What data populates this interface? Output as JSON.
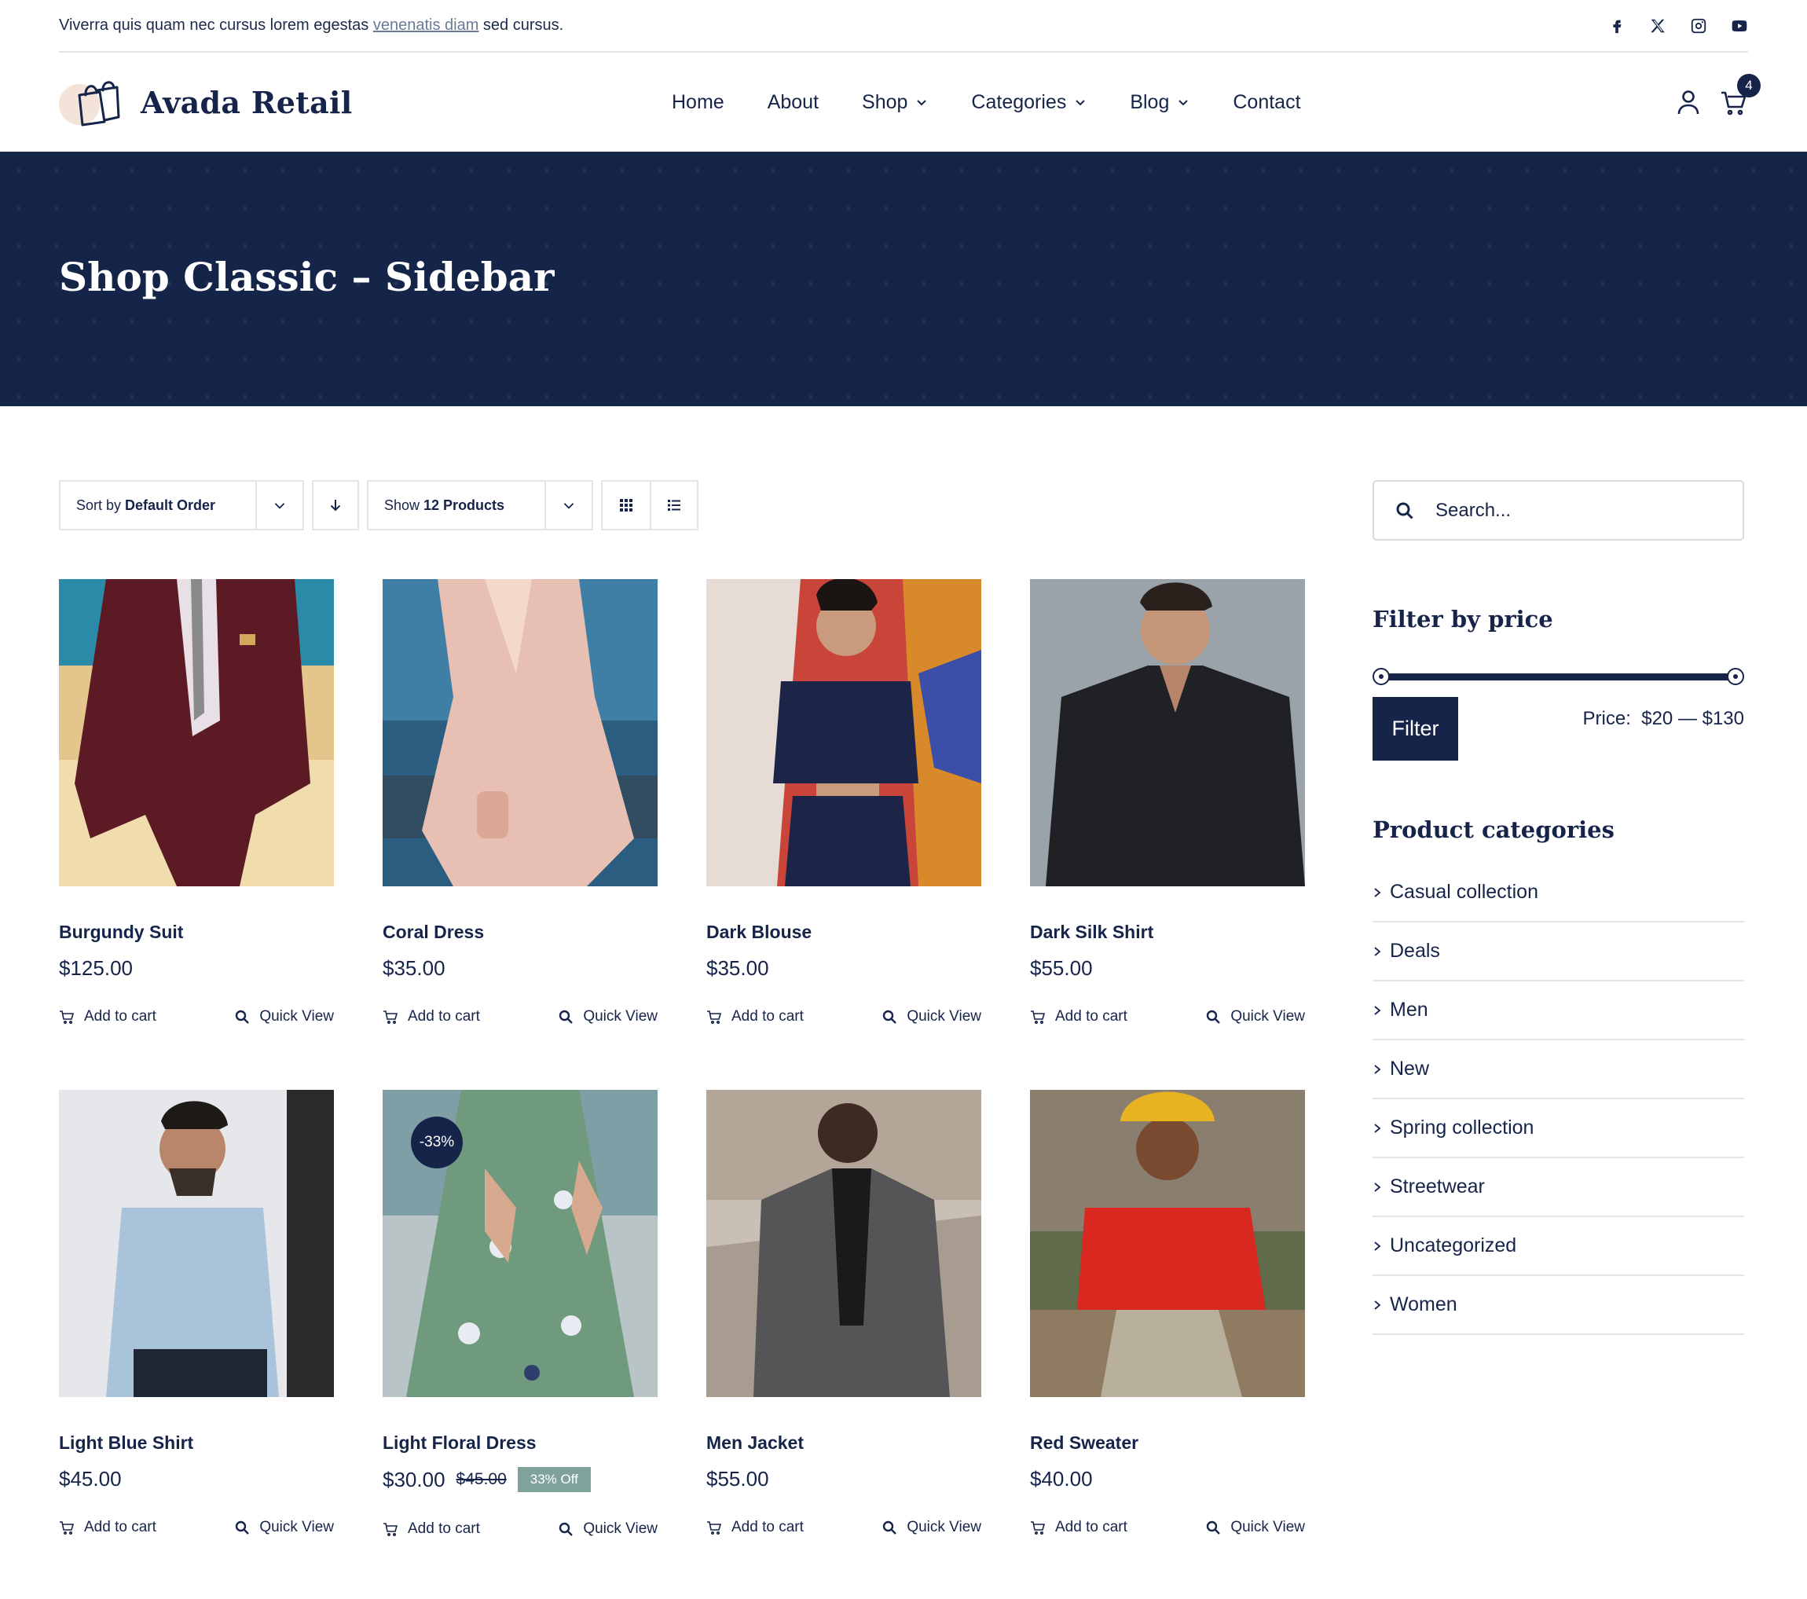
{
  "topbar": {
    "message_before": "Viverra quis quam nec cursus lorem egestas ",
    "message_link": "venenatis diam",
    "message_after": " sed cursus.",
    "socials": [
      "facebook-icon",
      "x-icon",
      "instagram-icon",
      "youtube-icon"
    ]
  },
  "header": {
    "logo_text": "Avada Retail",
    "nav": [
      {
        "label": "Home",
        "dropdown": false
      },
      {
        "label": "About",
        "dropdown": false
      },
      {
        "label": "Shop",
        "dropdown": true
      },
      {
        "label": "Categories",
        "dropdown": true
      },
      {
        "label": "Blog",
        "dropdown": true
      },
      {
        "label": "Contact",
        "dropdown": false
      }
    ],
    "cart_count": "4"
  },
  "hero": {
    "title": "Shop Classic – Sidebar"
  },
  "toolbar": {
    "sort_prefix": "Sort by ",
    "sort_value": "Default Order",
    "show_prefix": "Show ",
    "show_value": "12 Products"
  },
  "products": [
    {
      "name": "Burgundy Suit",
      "price": "$125.00",
      "add_label": "Add to cart",
      "quick_label": "Quick View"
    },
    {
      "name": "Coral Dress",
      "price": "$35.00",
      "add_label": "Add to cart",
      "quick_label": "Quick View"
    },
    {
      "name": "Dark Blouse",
      "price": "$35.00",
      "add_label": "Add to cart",
      "quick_label": "Quick View"
    },
    {
      "name": "Dark Silk Shirt",
      "price": "$55.00",
      "add_label": "Add to cart",
      "quick_label": "Quick View"
    },
    {
      "name": "Light Blue Shirt",
      "price": "$45.00",
      "add_label": "Add to cart",
      "quick_label": "Quick View"
    },
    {
      "name": "Light Floral Dress",
      "price": "$30.00",
      "old_price": "$45.00",
      "off_label": "33% Off",
      "sale_badge": "-33%",
      "add_label": "Add to cart",
      "quick_label": "Quick View"
    },
    {
      "name": "Men Jacket",
      "price": "$55.00",
      "add_label": "Add to cart",
      "quick_label": "Quick View"
    },
    {
      "name": "Red Sweater",
      "price": "$40.00",
      "add_label": "Add to cart",
      "quick_label": "Quick View"
    }
  ],
  "sidebar": {
    "search_placeholder": "Search...",
    "price_title": "Filter by price",
    "filter_label": "Filter",
    "price_range": "Price:  $20 — $130",
    "categories_title": "Product categories",
    "categories": [
      "Casual collection",
      "Deals",
      "Men",
      "New",
      "Spring collection",
      "Streetwear",
      "Uncategorized",
      "Women"
    ]
  },
  "colors": {
    "navy": "#15254a",
    "border": "#e3e5ea",
    "sale_tag": "#7fa39b"
  }
}
